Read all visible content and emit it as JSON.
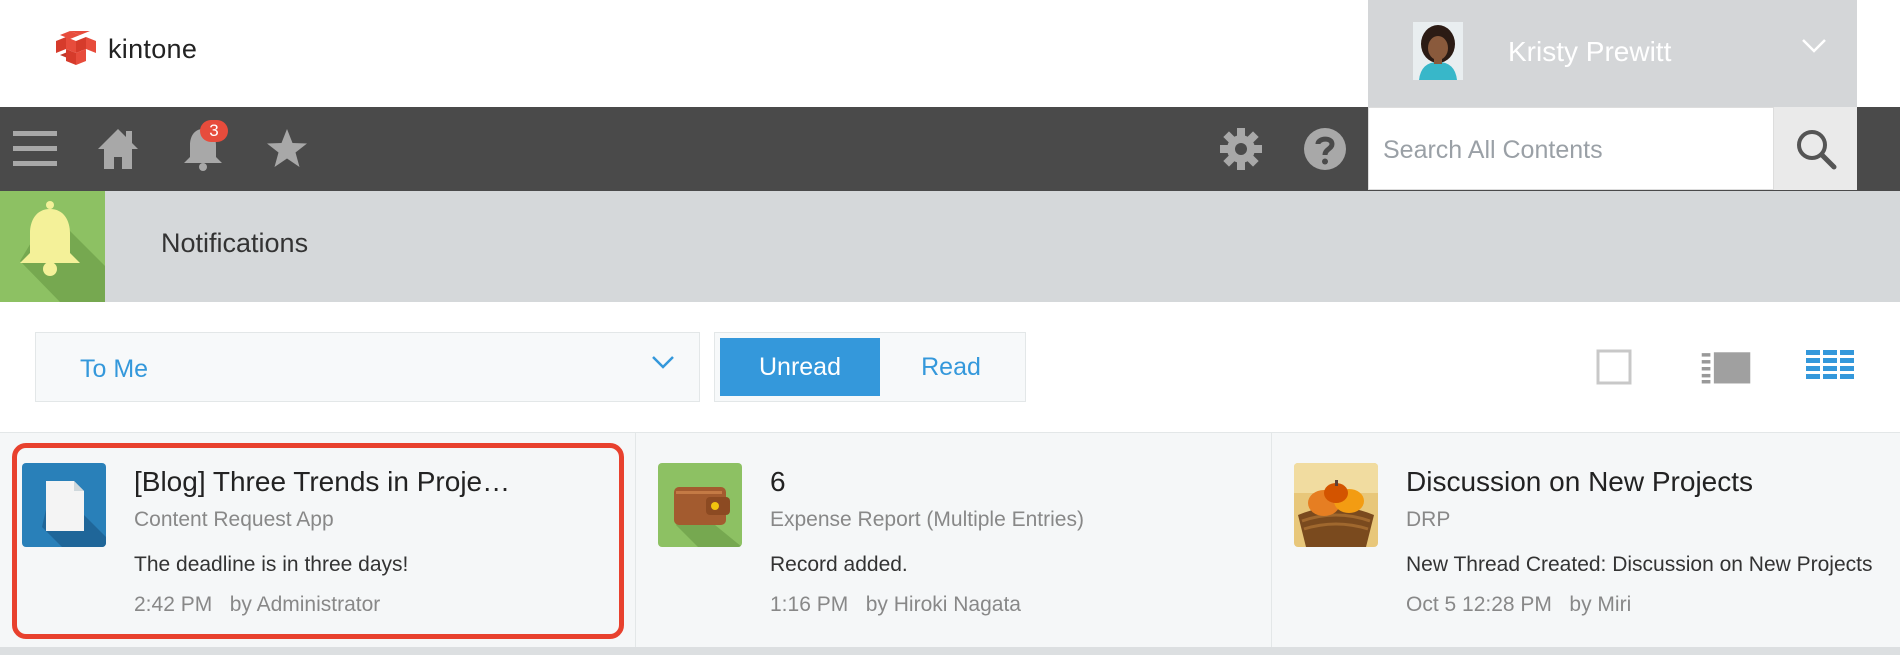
{
  "app": {
    "name": "kintone"
  },
  "user": {
    "name": "Kristy Prewitt"
  },
  "nav": {
    "notification_count": "3"
  },
  "search": {
    "placeholder": "Search All Contents"
  },
  "page": {
    "title": "Notifications"
  },
  "filters": {
    "recipient_selected": "To Me",
    "unread_label": "Unread",
    "read_label": "Read",
    "selected_state": "Unread"
  },
  "notifications": [
    {
      "title": "[Blog] Three Trends in Proje…",
      "app": "Content Request App",
      "message": "The deadline is in three days!",
      "time": "2:42 PM",
      "author": "by Administrator",
      "icon": "document-icon"
    },
    {
      "title": "6",
      "app": "Expense Report (Multiple Entries)",
      "message": "Record added.",
      "time": "1:16 PM",
      "author": "by Hiroki Nagata",
      "icon": "wallet-icon"
    },
    {
      "title": "Discussion on New Projects",
      "app": "DRP",
      "message": "New Thread Created: Discussion on New Projects",
      "time": "Oct 5 12:28 PM",
      "author": "by Miri",
      "icon": "pumpkin-photo"
    }
  ],
  "colors": {
    "accent": "#3498db",
    "navbar": "#4a4a4a",
    "badge": "#e74c3c",
    "highlight": "#e8412e",
    "title_icon_bg": "#8dc163"
  }
}
